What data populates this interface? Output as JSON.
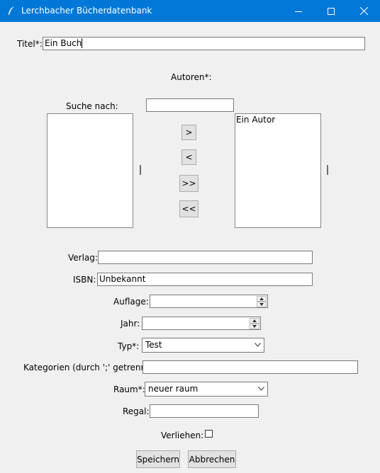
{
  "window": {
    "title": "Lerchbacher Bücherdatenbank"
  },
  "form": {
    "title_label": "Titel*:",
    "title_value": "Ein Buch",
    "authors_label": "Autoren*:",
    "search_label": "Suche nach:",
    "search_value": "",
    "available_authors": [],
    "selected_authors": [
      "Ein Autor"
    ],
    "btn_add": ">",
    "btn_remove": "<",
    "btn_add_all": ">>",
    "btn_remove_all": "<<",
    "publisher_label": "Verlag:",
    "publisher_value": "",
    "isbn_label": "ISBN:",
    "isbn_value": "Unbekannt",
    "edition_label": "Auflage:",
    "edition_value": "",
    "year_label": "Jahr:",
    "year_value": "",
    "type_label": "Typ*:",
    "type_value": "Test",
    "categories_label": "Kategorien (durch ';' getrennt):",
    "categories_value": "",
    "room_label": "Raum*:",
    "room_value": "neuer raum",
    "shelf_label": "Regal:",
    "shelf_value": "",
    "lent_label": "Verliehen:",
    "lent_checked": false,
    "save_label": "Speichern",
    "cancel_label": "Abbrechen"
  }
}
